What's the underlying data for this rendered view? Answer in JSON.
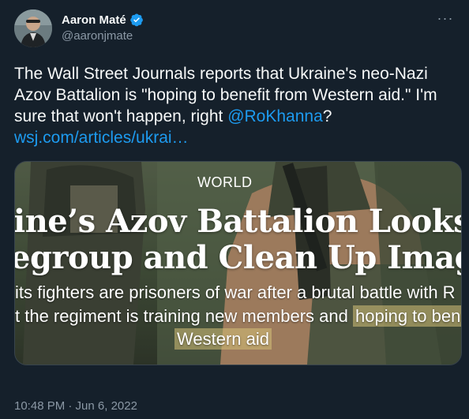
{
  "author": {
    "display_name": "Aaron Maté",
    "handle": "@aaronjmate",
    "verified": true
  },
  "tweet": {
    "text_before_mention": "The Wall Street Journals reports that Ukraine's neo-Nazi Azov Battalion is \"hoping to benefit from Western aid.\" I'm sure that won't happen, right ",
    "mention": "@RoKhanna",
    "after_mention": "?",
    "link": "wsj.com/articles/ukrai…"
  },
  "media": {
    "section": "WORLD",
    "headline_line1": "ine’s Azov Battalion Looks",
    "headline_line2": "egroup and Clean Up Image",
    "sub_line1": "its fighters are prisoners of war after a brutal battle with R",
    "sub_line2_plain": "t the regiment is training new members and ",
    "sub_line2_highlight": "hoping to ben",
    "sub_line3_highlight": "Western aid"
  },
  "timestamp": "10:48 PM · Jun 6, 2022",
  "colors": {
    "background": "#15202b",
    "link": "#1d9bf0",
    "muted": "#8b98a5",
    "highlight": "#d6c178"
  },
  "icons": {
    "verified": "verified-badge-icon",
    "more": "more-dots-icon"
  }
}
